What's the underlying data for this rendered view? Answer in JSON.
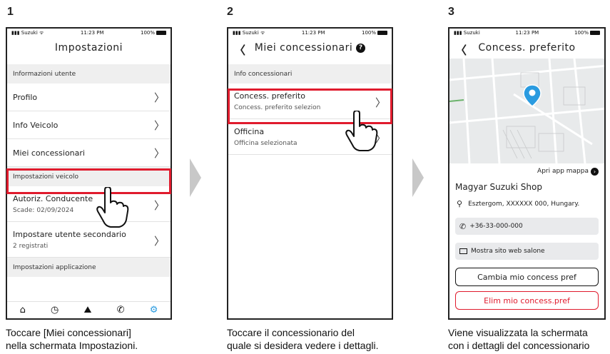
{
  "steps": [
    {
      "number": "1",
      "caption_line1": "Toccare [Miei concessionari]",
      "caption_line2": "nella schermata Impostazioni."
    },
    {
      "number": "2",
      "caption_line1": "Toccare il concessionario del",
      "caption_line2": "quale si desidera vedere i dettagli."
    },
    {
      "number": "3",
      "caption_line1": "Viene visualizzata la schermata",
      "caption_line2": "con i dettagli del concessionario"
    }
  ],
  "status": {
    "carrier": "Suzuki",
    "time": "11:23 PM",
    "battery": "100%"
  },
  "screen1": {
    "title": "Impostazioni",
    "section_user": "Informazioni utente",
    "profile": "Profilo",
    "vehicle_info": "Info Veicolo",
    "my_dealers": "Miei concessionari",
    "section_vehicle": "Impostazioni veicolo",
    "driver_auth": "Autoriz. Conducente",
    "driver_auth_sub": "Scade: 02/09/2024",
    "secondary_user": "Impostare utente secondario",
    "secondary_user_sub": "2 registrati",
    "section_app": "Impostazioni applicazione"
  },
  "screen2": {
    "title": "Miei concessionari",
    "section": "Info concessionari",
    "preferred": "Concess. preferito",
    "preferred_sub": "Concess. preferito selezion",
    "workshop": "Officina",
    "workshop_sub": "Officina selezionata"
  },
  "screen3": {
    "title": "Concess. preferito",
    "map_link": "Apri app mappa",
    "dealer_name": "Magyar Suzuki Shop",
    "address": "Esztergom, XXXXXX 000, Hungary.",
    "phone": "+36-33-000-000",
    "website": "Mostra sito web salone",
    "change_btn": "Cambia mio concess pref",
    "delete_btn": "Elim mio concess.pref"
  },
  "colors": {
    "highlight": "#e01b2d",
    "active_tab": "#2a9be0",
    "pin": "#2a9be0"
  },
  "icons": [
    "home-icon",
    "history-icon",
    "map-icon",
    "phone-icon",
    "gear-icon",
    "hand-pointer-icon",
    "location-pin-icon",
    "telephone-icon",
    "monitor-icon",
    "arrow-circle-icon"
  ]
}
